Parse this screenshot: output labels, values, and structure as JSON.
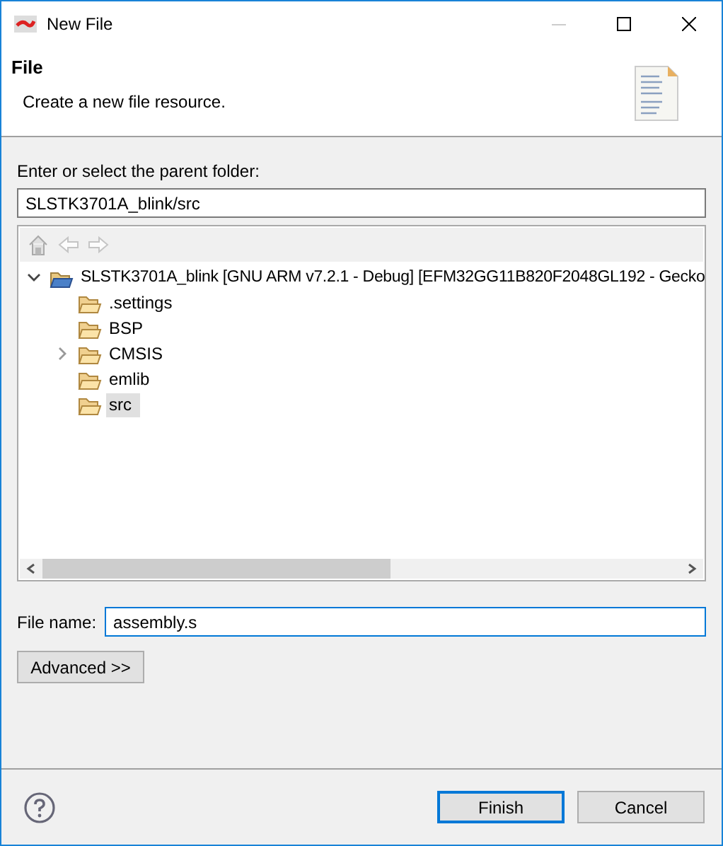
{
  "window": {
    "title": "New File"
  },
  "header": {
    "title": "File",
    "description": "Create a new file resource."
  },
  "parent_folder": {
    "label": "Enter or select the parent folder:",
    "value": "SLSTK3701A_blink/src"
  },
  "tree": {
    "toolbar": [
      {
        "kind": "home",
        "disabled": true
      },
      {
        "kind": "back",
        "disabled": true
      },
      {
        "kind": "forward",
        "disabled": true
      }
    ],
    "items": [
      {
        "label": "SLSTK3701A_blink [GNU ARM v7.2.1 - Debug] [EFM32GG11B820F2048GL192 - Gecko",
        "kind": "project",
        "expanded": true,
        "selected": false,
        "children": [
          {
            "label": ".settings",
            "kind": "folder",
            "selected": false
          },
          {
            "label": "BSP",
            "kind": "folder",
            "selected": false
          },
          {
            "label": "CMSIS",
            "kind": "folder",
            "expanded": false,
            "selected": false
          },
          {
            "label": "emlib",
            "kind": "folder",
            "selected": false
          },
          {
            "label": "src",
            "kind": "folder",
            "selected": true
          }
        ]
      }
    ]
  },
  "file_name": {
    "label": "File name:",
    "value": "assembly.s",
    "focused": true
  },
  "advanced_button": "Advanced >>",
  "buttons": [
    {
      "label": "Finish",
      "default": true
    },
    {
      "label": "Cancel",
      "default": false
    }
  ]
}
